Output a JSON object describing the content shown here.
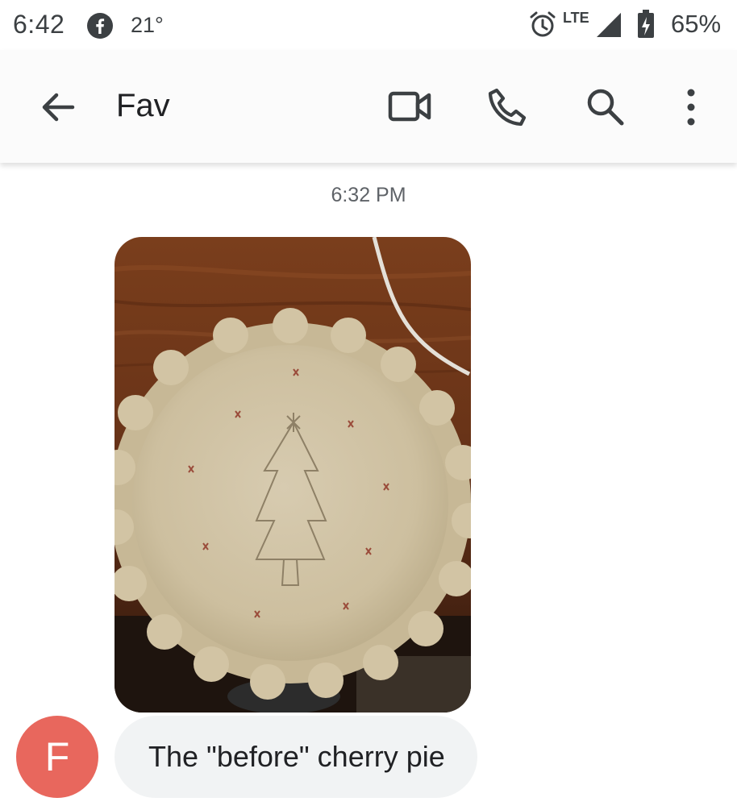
{
  "status_bar": {
    "time": "6:42",
    "temperature": "21°",
    "network": "LTE",
    "battery_percent": "65%",
    "icons": [
      "facebook-icon",
      "alarm-icon",
      "signal-icon",
      "battery-charging-icon"
    ]
  },
  "app_bar": {
    "title": "Fav",
    "icons": [
      "back-arrow-icon",
      "video-call-icon",
      "phone-icon",
      "search-icon",
      "more-vert-icon"
    ]
  },
  "conversation": {
    "timestamp": "6:32 PM",
    "messages": [
      {
        "type": "image",
        "image_subject": "uncooked pie crust with a Christmas tree design"
      },
      {
        "type": "text",
        "avatar_letter": "F",
        "text": "The \"before\" cherry pie"
      }
    ]
  },
  "colors": {
    "avatar": "#e8675d",
    "bubble": "#f1f3f4",
    "icon": "#3c4043",
    "app_bar": "#fbfbfb"
  }
}
